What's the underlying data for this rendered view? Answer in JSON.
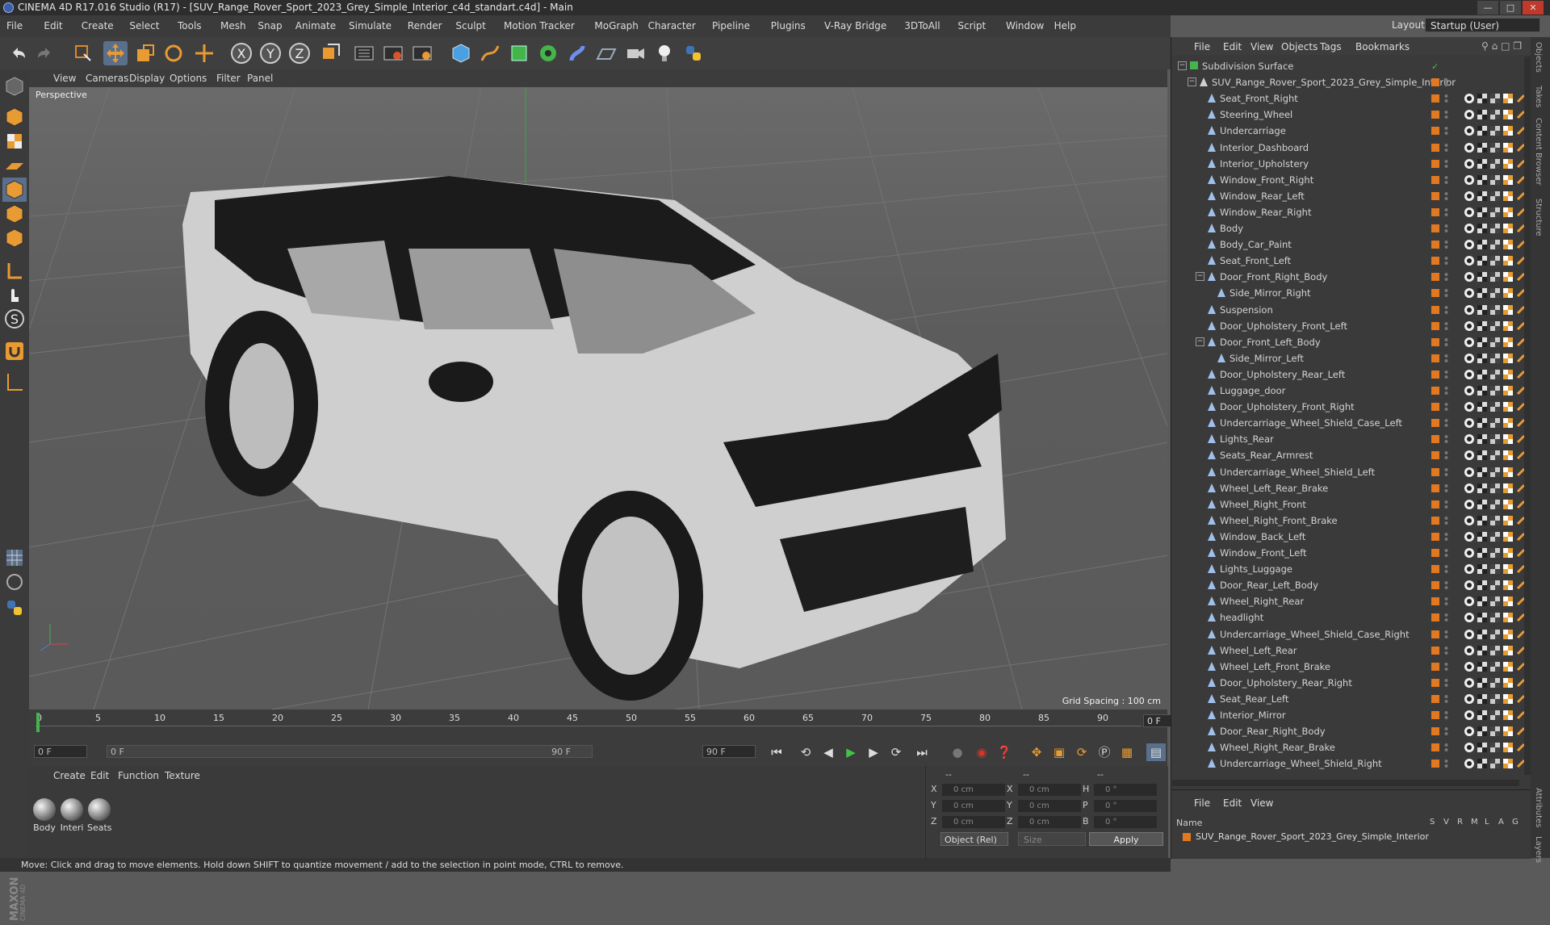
{
  "window": {
    "title": "CINEMA 4D R17.016 Studio (R17) - [SUV_Range_Rover_Sport_2023_Grey_Simple_Interior_c4d_standart.c4d] - Main",
    "layout_label": "Layout:",
    "layout_value": "Startup (User)"
  },
  "menubar": [
    "File",
    "Edit",
    "Create",
    "Select",
    "Tools",
    "Mesh",
    "Snap",
    "Animate",
    "Simulate",
    "Render",
    "Sculpt",
    "Motion Tracker",
    "MoGraph",
    "Character",
    "Pipeline",
    "Plugins",
    "V-Ray Bridge",
    "3DToAll",
    "Script",
    "Window",
    "Help"
  ],
  "viewport": {
    "menu": [
      "View",
      "Cameras",
      "Display",
      "Options",
      "Filter",
      "Panel"
    ],
    "name": "Perspective",
    "grid_spacing": "Grid Spacing : 100 cm"
  },
  "timeline": {
    "ticks": [
      "0",
      "5",
      "10",
      "15",
      "20",
      "25",
      "30",
      "35",
      "40",
      "45",
      "50",
      "55",
      "60",
      "65",
      "70",
      "75",
      "80",
      "85",
      "90"
    ],
    "current_frame": "0 F",
    "start_field": "0 F",
    "range_start": "0 F",
    "range_end": "90 F",
    "end_field": "90 F"
  },
  "materials": {
    "menu": [
      "Create",
      "Edit",
      "Function",
      "Texture"
    ],
    "items": [
      "Body",
      "Interi",
      "Seats"
    ]
  },
  "coordinates": {
    "header": [
      "--",
      "--",
      "--"
    ],
    "rows": [
      {
        "a": "X",
        "av": "0 cm",
        "b": "X",
        "bv": "0 cm",
        "c": "H",
        "cv": "0 °"
      },
      {
        "a": "Y",
        "av": "0 cm",
        "b": "Y",
        "bv": "0 cm",
        "c": "P",
        "cv": "0 °"
      },
      {
        "a": "Z",
        "av": "0 cm",
        "b": "Z",
        "bv": "0 cm",
        "c": "B",
        "cv": "0 °"
      }
    ],
    "mode": "Object (Rel)",
    "size": "Size",
    "apply": "Apply"
  },
  "status": "Move: Click and drag to move elements. Hold down SHIFT to quantize movement / add to the selection in point mode, CTRL to remove.",
  "objects": {
    "menu": [
      "File",
      "Edit",
      "View",
      "Objects",
      "Tags",
      "Bookmarks"
    ],
    "root": "Subdivision Surface",
    "group": "SUV_Range_Rover_Sport_2023_Grey_Simple_Interior",
    "items": [
      {
        "name": "Seat_Front_Right",
        "level": 2
      },
      {
        "name": "Steering_Wheel",
        "level": 2
      },
      {
        "name": "Undercarriage",
        "level": 2
      },
      {
        "name": "Interior_Dashboard",
        "level": 2
      },
      {
        "name": "Interior_Upholstery",
        "level": 2
      },
      {
        "name": "Window_Front_Right",
        "level": 2
      },
      {
        "name": "Window_Rear_Left",
        "level": 2
      },
      {
        "name": "Window_Rear_Right",
        "level": 2
      },
      {
        "name": "Body",
        "level": 2
      },
      {
        "name": "Body_Car_Paint",
        "level": 2
      },
      {
        "name": "Seat_Front_Left",
        "level": 2
      },
      {
        "name": "Door_Front_Right_Body",
        "level": 2
      },
      {
        "name": "Side_Mirror_Right",
        "level": 3
      },
      {
        "name": "Suspension",
        "level": 2
      },
      {
        "name": "Door_Upholstery_Front_Left",
        "level": 2
      },
      {
        "name": "Door_Front_Left_Body",
        "level": 2
      },
      {
        "name": "Side_Mirror_Left",
        "level": 3
      },
      {
        "name": "Door_Upholstery_Rear_Left",
        "level": 2
      },
      {
        "name": "Luggage_door",
        "level": 2
      },
      {
        "name": "Door_Upholstery_Front_Right",
        "level": 2
      },
      {
        "name": "Undercarriage_Wheel_Shield_Case_Left",
        "level": 2
      },
      {
        "name": "Lights_Rear",
        "level": 2
      },
      {
        "name": "Seats_Rear_Armrest",
        "level": 2
      },
      {
        "name": "Undercarriage_Wheel_Shield_Left",
        "level": 2
      },
      {
        "name": "Wheel_Left_Rear_Brake",
        "level": 2
      },
      {
        "name": "Wheel_Right_Front",
        "level": 2
      },
      {
        "name": "Wheel_Right_Front_Brake",
        "level": 2
      },
      {
        "name": "Window_Back_Left",
        "level": 2
      },
      {
        "name": "Window_Front_Left",
        "level": 2
      },
      {
        "name": "Lights_Luggage",
        "level": 2
      },
      {
        "name": "Door_Rear_Left_Body",
        "level": 2
      },
      {
        "name": "Wheel_Right_Rear",
        "level": 2
      },
      {
        "name": "headlight",
        "level": 2
      },
      {
        "name": "Undercarriage_Wheel_Shield_Case_Right",
        "level": 2
      },
      {
        "name": "Wheel_Left_Rear",
        "level": 2
      },
      {
        "name": "Wheel_Left_Front_Brake",
        "level": 2
      },
      {
        "name": "Door_Upholstery_Rear_Right",
        "level": 2
      },
      {
        "name": "Seat_Rear_Left",
        "level": 2
      },
      {
        "name": "Interior_Mirror",
        "level": 2
      },
      {
        "name": "Door_Rear_Right_Body",
        "level": 2
      },
      {
        "name": "Wheel_Right_Rear_Brake",
        "level": 2
      },
      {
        "name": "Undercarriage_Wheel_Shield_Right",
        "level": 2
      }
    ]
  },
  "layers": {
    "menu": [
      "File",
      "Edit",
      "View"
    ],
    "name_header": "Name",
    "cols": [
      "S",
      "V",
      "R",
      "M",
      "L",
      "A",
      "G"
    ],
    "item": "SUV_Range_Rover_Sport_2023_Grey_Simple_Interior"
  },
  "side_tabs": [
    "Objects",
    "Takes",
    "Content Browser",
    "Structure",
    "Attributes",
    "Layers"
  ],
  "colors": {
    "accent_orange": "#e2781f",
    "bg": "#3a3a3a",
    "viewport": "#5c5c5c"
  }
}
